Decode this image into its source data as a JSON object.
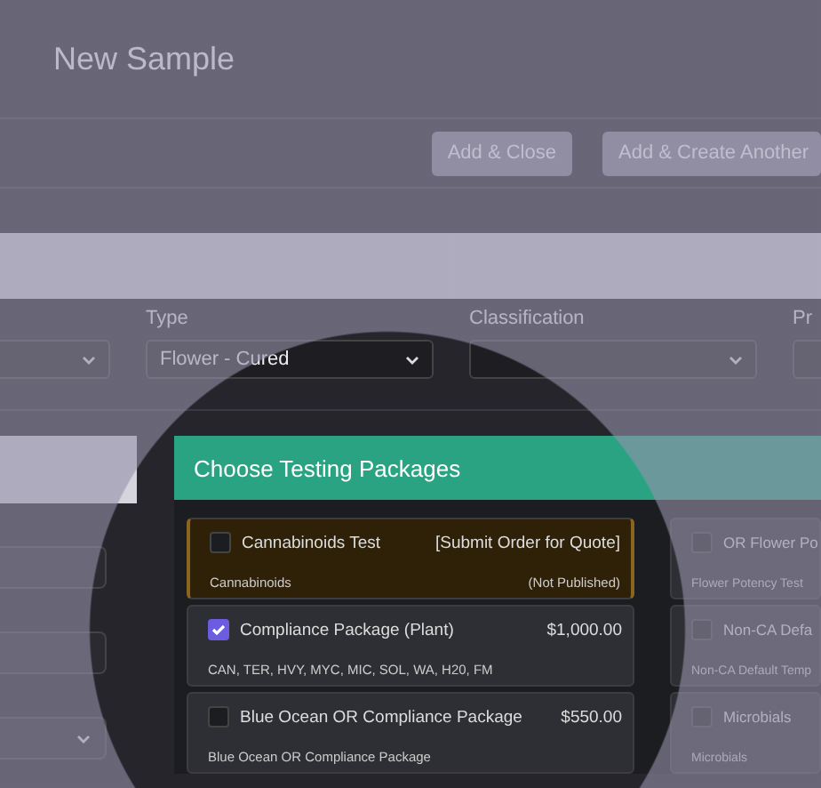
{
  "header": {
    "title": "New Sample"
  },
  "actions": [
    {
      "label": "Add & Close"
    },
    {
      "label": "Add & Create Another"
    }
  ],
  "fields": [
    {
      "kind": "select"
    },
    {
      "kind": "select",
      "label": "Type",
      "value": "Flower - Cured"
    },
    {
      "kind": "select",
      "label": "Classification"
    },
    {
      "kind": "select",
      "label": "Pr"
    }
  ],
  "side_fields": [
    {
      "kind": "text"
    },
    {
      "kind": "text"
    },
    {
      "kind": "select"
    }
  ],
  "modal": {
    "title": "Choose Testing Packages",
    "columns": [
      [
        {
          "name": "Cannabinoids Test",
          "price": "[Submit Order for Quote]",
          "description": "Cannabinoids",
          "note": "(Not Published)",
          "published": false,
          "checked": false
        },
        {
          "name": "Compliance Package (Plant)",
          "price": "$1,000.00",
          "description": "CAN, TER, HVY, MYC, MIC, SOL, WA, H20, FM",
          "published": true,
          "checked": true
        },
        {
          "name": "Blue Ocean OR Compliance Package",
          "price": "$550.00",
          "description": "Blue Ocean OR Compliance Package",
          "published": true,
          "checked": false
        }
      ],
      [
        {
          "name": "OR Flower Po",
          "description": "Flower Potency Test",
          "published": true,
          "checked": false
        },
        {
          "name": "Non-CA Defa",
          "description": "Non-CA Default Temp",
          "published": true,
          "checked": false
        },
        {
          "name": "Microbials",
          "description": "Microbials",
          "published": true,
          "checked": false
        }
      ]
    ]
  }
}
